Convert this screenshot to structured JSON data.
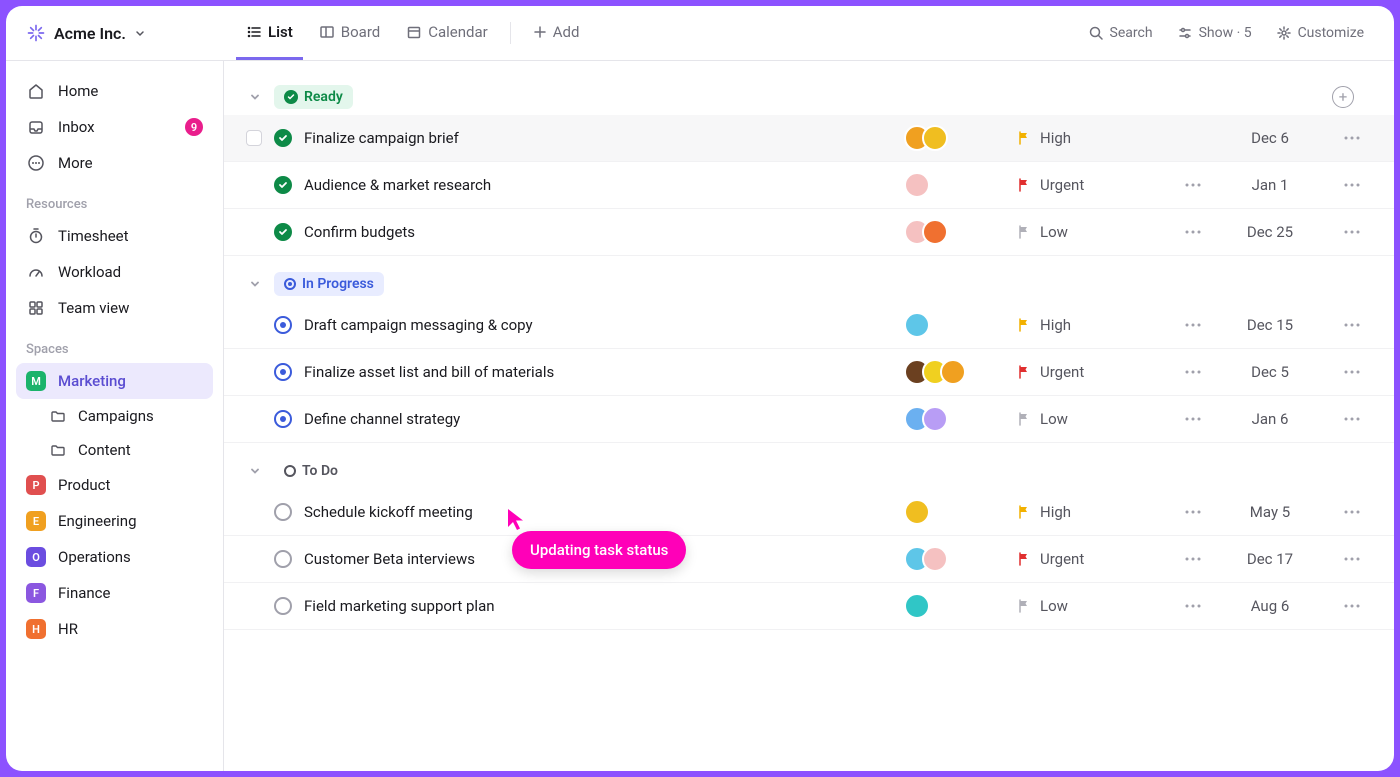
{
  "workspace": {
    "name": "Acme Inc."
  },
  "viewTabs": {
    "list": "List",
    "board": "Board",
    "calendar": "Calendar",
    "add": "Add"
  },
  "toolbar": {
    "search": "Search",
    "show": "Show · 5",
    "customize": "Customize"
  },
  "nav": {
    "home": "Home",
    "inbox": "Inbox",
    "inbox_badge": "9",
    "more": "More"
  },
  "sections": {
    "resources": "Resources",
    "spaces": "Spaces"
  },
  "resources": {
    "timesheet": "Timesheet",
    "workload": "Workload",
    "teamview": "Team view"
  },
  "spaces": [
    {
      "letter": "M",
      "label": "Marketing",
      "color": "#1bb36b",
      "active": true,
      "children": [
        {
          "label": "Campaigns"
        },
        {
          "label": "Content"
        }
      ]
    },
    {
      "letter": "P",
      "label": "Product",
      "color": "#e04f4f"
    },
    {
      "letter": "E",
      "label": "Engineering",
      "color": "#f0a020"
    },
    {
      "letter": "O",
      "label": "Operations",
      "color": "#6b4de0"
    },
    {
      "letter": "F",
      "label": "Finance",
      "color": "#8b57e0"
    },
    {
      "letter": "H",
      "label": "HR",
      "color": "#f07030"
    }
  ],
  "groups": [
    {
      "status": "Ready",
      "pill_bg": "#e3f6ec",
      "pill_color": "#0d8a47",
      "circle_type": "check",
      "circle_color": "#0d8a47",
      "show_add": true,
      "tasks": [
        {
          "title": "Finalize campaign brief",
          "avatars": [
            "#f0a020",
            "#f0be20"
          ],
          "priority": "High",
          "priority_color": "#f2b100",
          "date": "Dec 6",
          "hovered": true,
          "subtasks": false
        },
        {
          "title": "Audience & market research",
          "avatars": [
            "#f5c1c1"
          ],
          "priority": "Urgent",
          "priority_color": "#e02f2f",
          "date": "Jan 1",
          "subtasks": true
        },
        {
          "title": "Confirm budgets",
          "avatars": [
            "#f5c1c1",
            "#f07030"
          ],
          "priority": "Low",
          "priority_color": "#b0b0b8",
          "date": "Dec 25",
          "subtasks": true
        }
      ]
    },
    {
      "status": "In Progress",
      "pill_bg": "#e8ecff",
      "pill_color": "#3b5bdb",
      "circle_type": "ring",
      "circle_color": "#3b5bdb",
      "tasks": [
        {
          "title": "Draft campaign messaging & copy",
          "avatars": [
            "#5ec6e8"
          ],
          "priority": "High",
          "priority_color": "#f2b100",
          "date": "Dec 15",
          "subtasks": true
        },
        {
          "title": "Finalize asset list and bill of materials",
          "avatars": [
            "#6b4020",
            "#f0d020",
            "#f0a020"
          ],
          "priority": "Urgent",
          "priority_color": "#e02f2f",
          "date": "Dec 5",
          "subtasks": true
        },
        {
          "title": "Define channel strategy",
          "avatars": [
            "#6bb0f0",
            "#b89df5"
          ],
          "priority": "Low",
          "priority_color": "#b0b0b8",
          "date": "Jan 6",
          "subtasks": true
        }
      ]
    },
    {
      "status": "To Do",
      "pill_bg": "transparent",
      "pill_color": "#55555e",
      "circle_type": "empty",
      "circle_color": "#a0a0ab",
      "tasks": [
        {
          "title": "Schedule kickoff meeting",
          "avatars": [
            "#f0be20"
          ],
          "priority": "High",
          "priority_color": "#f2b100",
          "date": "May 5",
          "subtasks": true
        },
        {
          "title": "Customer Beta interviews",
          "avatars": [
            "#5ec6e8",
            "#f5c1c1"
          ],
          "priority": "Urgent",
          "priority_color": "#e02f2f",
          "date": "Dec 17",
          "subtasks": true
        },
        {
          "title": "Field marketing support plan",
          "avatars": [
            "#30c6c6"
          ],
          "priority": "Low",
          "priority_color": "#b0b0b8",
          "date": "Aug 6",
          "subtasks": true
        }
      ]
    }
  ],
  "tooltip": "Updating task status"
}
